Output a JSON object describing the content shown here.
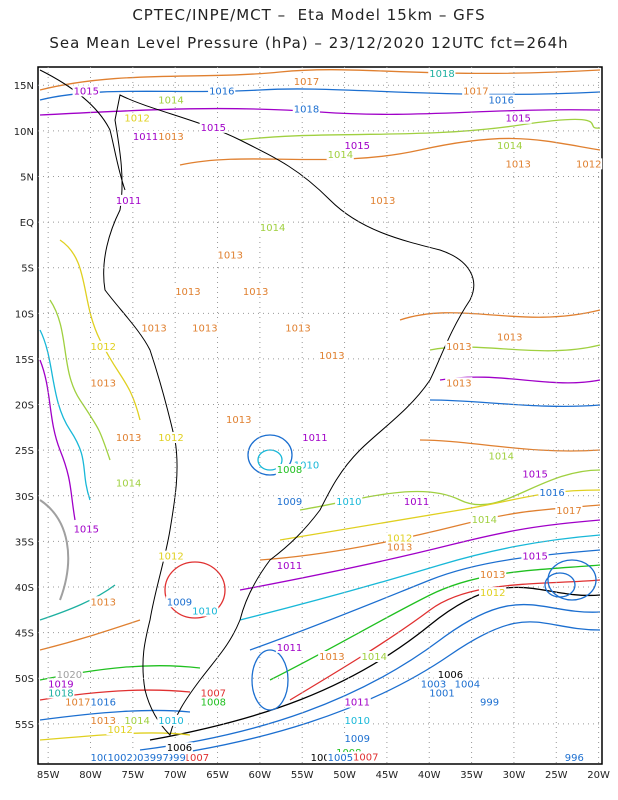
{
  "header": {
    "line1": "CPTEC/INPE/MCT –  Eta Model 15km – GFS",
    "line2": "Sea Mean Level Pressure (hPa) – 23/12/2020 12UTC fct=264h"
  },
  "axes": {
    "lat_labels": [
      "15N",
      "10N",
      "5N",
      "EQ",
      "5S",
      "10S",
      "15S",
      "20S",
      "25S",
      "30S",
      "35S",
      "40S",
      "45S",
      "50S",
      "55S"
    ],
    "lon_labels": [
      "85W",
      "80W",
      "75W",
      "70W",
      "65W",
      "60W",
      "55W",
      "50W",
      "45W",
      "40W",
      "35W",
      "30W",
      "25W",
      "20W"
    ]
  },
  "contour_labels": [
    {
      "text": "1015",
      "color": "#a000c8",
      "lon": -82,
      "lat": 14
    },
    {
      "text": "1016",
      "color": "#1c6fd0",
      "lon": -66,
      "lat": 14
    },
    {
      "text": "1017",
      "color": "#e08030",
      "lon": -56,
      "lat": 15
    },
    {
      "text": "1018",
      "color": "#1db0a0",
      "lon": -40,
      "lat": 16
    },
    {
      "text": "1017",
      "color": "#e08030",
      "lon": -36,
      "lat": 14
    },
    {
      "text": "1016",
      "color": "#1c6fd0",
      "lon": -33,
      "lat": 13
    },
    {
      "text": "1018",
      "color": "#1c6fd0",
      "lon": -56,
      "lat": 12
    },
    {
      "text": "1015",
      "color": "#a000c8",
      "lon": -31,
      "lat": 11
    },
    {
      "text": "1012",
      "color": "#e0d020",
      "lon": -76,
      "lat": 11
    },
    {
      "text": "1014",
      "color": "#a0d040",
      "lon": -72,
      "lat": 13
    },
    {
      "text": "1011",
      "color": "#a000c8",
      "lon": -75,
      "lat": 9
    },
    {
      "text": "1013",
      "color": "#e08030",
      "lon": -72,
      "lat": 9
    },
    {
      "text": "1015",
      "color": "#a000c8",
      "lon": -67,
      "lat": 10
    },
    {
      "text": "1015",
      "color": "#a000c8",
      "lon": -50,
      "lat": 8
    },
    {
      "text": "1014",
      "color": "#a0d040",
      "lon": -52,
      "lat": 7
    },
    {
      "text": "1014",
      "color": "#a0d040",
      "lon": -32,
      "lat": 8
    },
    {
      "text": "1013",
      "color": "#e08030",
      "lon": -31,
      "lat": 6
    },
    {
      "text": "1012",
      "color": "#e08030",
      "lon": -22,
      "lat": 6
    },
    {
      "text": "1013",
      "color": "#e08030",
      "lon": -47,
      "lat": 2
    },
    {
      "text": "1011",
      "color": "#a000c8",
      "lon": -77,
      "lat": 2
    },
    {
      "text": "1014",
      "color": "#a0d040",
      "lon": -60,
      "lat": -1
    },
    {
      "text": "1013",
      "color": "#e08030",
      "lon": -65,
      "lat": -4
    },
    {
      "text": "1013",
      "color": "#e08030",
      "lon": -70,
      "lat": -8
    },
    {
      "text": "1013",
      "color": "#e08030",
      "lon": -62,
      "lat": -8
    },
    {
      "text": "1013",
      "color": "#e08030",
      "lon": -74,
      "lat": -12
    },
    {
      "text": "1013",
      "color": "#e08030",
      "lon": -68,
      "lat": -12
    },
    {
      "text": "1013",
      "color": "#e08030",
      "lon": -57,
      "lat": -12
    },
    {
      "text": "1013",
      "color": "#e08030",
      "lon": -53,
      "lat": -15
    },
    {
      "text": "1012",
      "color": "#e0d020",
      "lon": -80,
      "lat": -14
    },
    {
      "text": "1013",
      "color": "#e08030",
      "lon": -38,
      "lat": -14
    },
    {
      "text": "1013",
      "color": "#e08030",
      "lon": -32,
      "lat": -13
    },
    {
      "text": "1013",
      "color": "#e08030",
      "lon": -38,
      "lat": -18
    },
    {
      "text": "1013",
      "color": "#e08030",
      "lon": -80,
      "lat": -18
    },
    {
      "text": "1013",
      "color": "#e08030",
      "lon": -64,
      "lat": -22
    },
    {
      "text": "1012",
      "color": "#e0d020",
      "lon": -72,
      "lat": -24
    },
    {
      "text": "1013",
      "color": "#e08030",
      "lon": -77,
      "lat": -24
    },
    {
      "text": "1011",
      "color": "#a000c8",
      "lon": -55,
      "lat": -24
    },
    {
      "text": "1010",
      "color": "#18b8d8",
      "lon": -56,
      "lat": -27
    },
    {
      "text": "1014",
      "color": "#a0d040",
      "lon": -33,
      "lat": -26
    },
    {
      "text": "1015",
      "color": "#a000c8",
      "lon": -29,
      "lat": -28
    },
    {
      "text": "1016",
      "color": "#1c6fd0",
      "lon": -27,
      "lat": -30
    },
    {
      "text": "1017",
      "color": "#e08030",
      "lon": -25,
      "lat": -32
    },
    {
      "text": "1014",
      "color": "#a0d040",
      "lon": -35,
      "lat": -33
    },
    {
      "text": "1014",
      "color": "#a0d040",
      "lon": -77,
      "lat": -29
    },
    {
      "text": "1015",
      "color": "#a000c8",
      "lon": -82,
      "lat": -34
    },
    {
      "text": "1011",
      "color": "#a000c8",
      "lon": -43,
      "lat": -31
    },
    {
      "text": "1010",
      "color": "#18b8d8",
      "lon": -51,
      "lat": -31
    },
    {
      "text": "1009",
      "color": "#1c6fd0",
      "lon": -58,
      "lat": -31
    },
    {
      "text": "1012",
      "color": "#e0d020",
      "lon": -45,
      "lat": -35
    },
    {
      "text": "1013",
      "color": "#e08030",
      "lon": -45,
      "lat": -36
    },
    {
      "text": "1015",
      "color": "#a000c8",
      "lon": -29,
      "lat": -37
    },
    {
      "text": "1012",
      "color": "#e0d020",
      "lon": -72,
      "lat": -37
    },
    {
      "text": "1011",
      "color": "#a000c8",
      "lon": -58,
      "lat": -38
    },
    {
      "text": "1008",
      "color": "#20c020",
      "lon": -58,
      "lat": -27.5
    },
    {
      "text": "1013",
      "color": "#e08030",
      "lon": -34,
      "lat": -39
    },
    {
      "text": "1012",
      "color": "#e0d020",
      "lon": -34,
      "lat": -41
    },
    {
      "text": "1013",
      "color": "#e08030",
      "lon": -80,
      "lat": -42
    },
    {
      "text": "1009",
      "color": "#1c6fd0",
      "lon": -71,
      "lat": -42
    },
    {
      "text": "1010",
      "color": "#18b8d8",
      "lon": -68,
      "lat": -43
    },
    {
      "text": "1011",
      "color": "#a000c8",
      "lon": -58,
      "lat": -47
    },
    {
      "text": "1014",
      "color": "#a0d040",
      "lon": -48,
      "lat": -48
    },
    {
      "text": "1013",
      "color": "#e08030",
      "lon": -53,
      "lat": -48
    },
    {
      "text": "1006",
      "color": "#000000",
      "lon": -39,
      "lat": -50
    },
    {
      "text": "1003",
      "color": "#1c6fd0",
      "lon": -41,
      "lat": -51
    },
    {
      "text": "1004",
      "color": "#1c6fd0",
      "lon": -37,
      "lat": -51
    },
    {
      "text": "1001",
      "color": "#1c6fd0",
      "lon": -40,
      "lat": -52
    },
    {
      "text": "999",
      "color": "#1c6fd0",
      "lon": -34,
      "lat": -53
    },
    {
      "text": "1020",
      "color": "#a0a0a0",
      "lon": -84,
      "lat": -50
    },
    {
      "text": "1019",
      "color": "#a000c8",
      "lon": -85,
      "lat": -51
    },
    {
      "text": "1018",
      "color": "#1db0a0",
      "lon": -85,
      "lat": -52
    },
    {
      "text": "1017",
      "color": "#e08030",
      "lon": -83,
      "lat": -53
    },
    {
      "text": "1016",
      "color": "#1c6fd0",
      "lon": -80,
      "lat": -53
    },
    {
      "text": "1013",
      "color": "#e08030",
      "lon": -80,
      "lat": -55
    },
    {
      "text": "1014",
      "color": "#a0d040",
      "lon": -76,
      "lat": -55
    },
    {
      "text": "1010",
      "color": "#18b8d8",
      "lon": -72,
      "lat": -55
    },
    {
      "text": "1012",
      "color": "#e0d020",
      "lon": -78,
      "lat": -56
    },
    {
      "text": "1008",
      "color": "#20c020",
      "lon": -67,
      "lat": -53
    },
    {
      "text": "1007",
      "color": "#e03030",
      "lon": -67,
      "lat": -52
    },
    {
      "text": "1011",
      "color": "#a000c8",
      "lon": -50,
      "lat": -53
    },
    {
      "text": "1010",
      "color": "#18b8d8",
      "lon": -50,
      "lat": -55
    },
    {
      "text": "1009",
      "color": "#1c6fd0",
      "lon": -50,
      "lat": -57
    },
    {
      "text": "1008",
      "color": "#20c020",
      "lon": -51,
      "lat": -58.5
    },
    {
      "text": "1007",
      "color": "#e03030",
      "lon": -49,
      "lat": -59
    },
    {
      "text": "1006",
      "color": "#000000",
      "lon": -71,
      "lat": -58
    },
    {
      "text": "1011",
      "color": "#a000c8",
      "lon": -79,
      "lat": -59
    },
    {
      "text": "1009",
      "color": "#1c6fd0",
      "lon": -80,
      "lat": -61
    },
    {
      "text": "1007",
      "color": "#e03030",
      "lon": -69,
      "lat": -59.5
    },
    {
      "text": "1006",
      "color": "#000000",
      "lon": -54,
      "lat": -61
    },
    {
      "text": "1005",
      "color": "#1c6fd0",
      "lon": -52,
      "lat": -60
    },
    {
      "text": "1004",
      "color": "#1c6fd0",
      "lon": -74,
      "lat": -62.5
    },
    {
      "text": "1003",
      "color": "#1c6fd0",
      "lon": -76,
      "lat": -63
    },
    {
      "text": "1002",
      "color": "#1c6fd0",
      "lon": -78,
      "lat": -63.5
    },
    {
      "text": "999",
      "color": "#1c6fd0",
      "lon": -71,
      "lat": -64
    },
    {
      "text": "997",
      "color": "#1c6fd0",
      "lon": -73,
      "lat": -65
    },
    {
      "text": "996",
      "color": "#1c6fd0",
      "lon": -24,
      "lat": -63
    }
  ]
}
